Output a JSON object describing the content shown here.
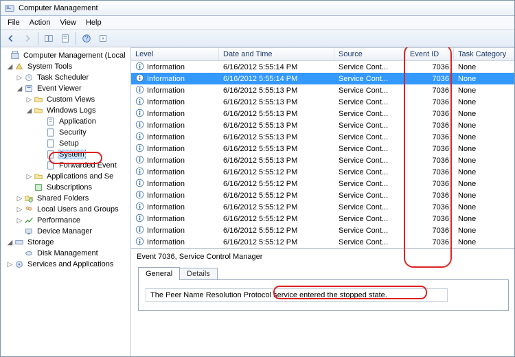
{
  "window": {
    "title": "Computer Management"
  },
  "menu": {
    "file": "File",
    "action": "Action",
    "view": "View",
    "help": "Help"
  },
  "tree": {
    "root": "Computer Management (Local",
    "system_tools": "System Tools",
    "task_scheduler": "Task Scheduler",
    "event_viewer": "Event Viewer",
    "custom_views": "Custom Views",
    "windows_logs": "Windows Logs",
    "application": "Application",
    "security": "Security",
    "setup": "Setup",
    "system": "System",
    "forwarded": "Forwarded Event",
    "apps_services": "Applications and Se",
    "subscriptions": "Subscriptions",
    "shared_folders": "Shared Folders",
    "local_users": "Local Users and Groups",
    "performance": "Performance",
    "device_manager": "Device Manager",
    "storage": "Storage",
    "disk_mgmt": "Disk Management",
    "services_apps": "Services and Applications"
  },
  "grid": {
    "headers": {
      "level": "Level",
      "date": "Date and Time",
      "source": "Source",
      "eid": "Event ID",
      "cat": "Task Category"
    },
    "rows": [
      {
        "level": "Information",
        "date": "6/16/2012 5:55:14 PM",
        "source": "Service Cont...",
        "eid": "7036",
        "cat": "None",
        "sel": false
      },
      {
        "level": "Information",
        "date": "6/16/2012 5:55:14 PM",
        "source": "Service Cont...",
        "eid": "7036",
        "cat": "None",
        "sel": true
      },
      {
        "level": "Information",
        "date": "6/16/2012 5:55:13 PM",
        "source": "Service Cont...",
        "eid": "7036",
        "cat": "None",
        "sel": false
      },
      {
        "level": "Information",
        "date": "6/16/2012 5:55:13 PM",
        "source": "Service Cont...",
        "eid": "7036",
        "cat": "None",
        "sel": false
      },
      {
        "level": "Information",
        "date": "6/16/2012 5:55:13 PM",
        "source": "Service Cont...",
        "eid": "7036",
        "cat": "None",
        "sel": false
      },
      {
        "level": "Information",
        "date": "6/16/2012 5:55:13 PM",
        "source": "Service Cont...",
        "eid": "7036",
        "cat": "None",
        "sel": false
      },
      {
        "level": "Information",
        "date": "6/16/2012 5:55:13 PM",
        "source": "Service Cont...",
        "eid": "7036",
        "cat": "None",
        "sel": false
      },
      {
        "level": "Information",
        "date": "6/16/2012 5:55:13 PM",
        "source": "Service Cont...",
        "eid": "7036",
        "cat": "None",
        "sel": false
      },
      {
        "level": "Information",
        "date": "6/16/2012 5:55:13 PM",
        "source": "Service Cont...",
        "eid": "7036",
        "cat": "None",
        "sel": false
      },
      {
        "level": "Information",
        "date": "6/16/2012 5:55:12 PM",
        "source": "Service Cont...",
        "eid": "7036",
        "cat": "None",
        "sel": false
      },
      {
        "level": "Information",
        "date": "6/16/2012 5:55:12 PM",
        "source": "Service Cont...",
        "eid": "7036",
        "cat": "None",
        "sel": false
      },
      {
        "level": "Information",
        "date": "6/16/2012 5:55:12 PM",
        "source": "Service Cont...",
        "eid": "7036",
        "cat": "None",
        "sel": false
      },
      {
        "level": "Information",
        "date": "6/16/2012 5:55:12 PM",
        "source": "Service Cont...",
        "eid": "7036",
        "cat": "None",
        "sel": false
      },
      {
        "level": "Information",
        "date": "6/16/2012 5:55:12 PM",
        "source": "Service Cont...",
        "eid": "7036",
        "cat": "None",
        "sel": false
      },
      {
        "level": "Information",
        "date": "6/16/2012 5:55:12 PM",
        "source": "Service Cont...",
        "eid": "7036",
        "cat": "None",
        "sel": false
      },
      {
        "level": "Information",
        "date": "6/16/2012 5:55:12 PM",
        "source": "Service Cont...",
        "eid": "7036",
        "cat": "None",
        "sel": false
      }
    ]
  },
  "details": {
    "header": "Event 7036, Service Control Manager",
    "tab_general": "General",
    "tab_details": "Details",
    "message": "The Peer Name Resolution Protocol service entered the stopped state."
  }
}
